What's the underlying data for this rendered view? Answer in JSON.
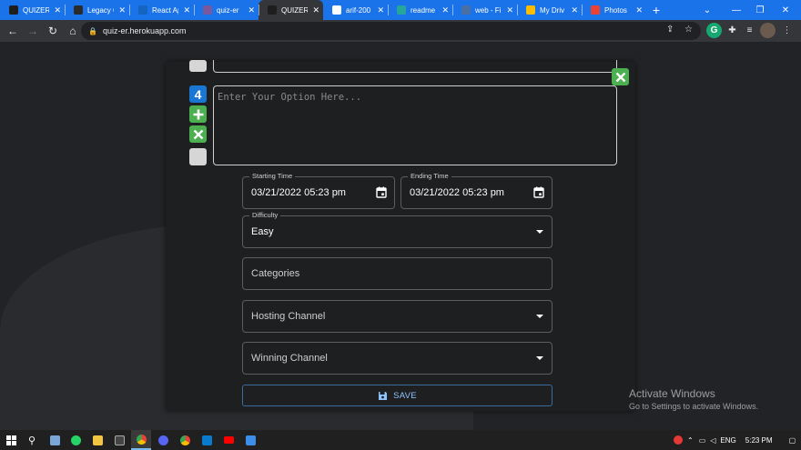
{
  "browser": {
    "tabs": [
      {
        "title": "QUIZER",
        "favicon": "quizer-icon",
        "color": "#1e1e1e",
        "active": false
      },
      {
        "title": "Legacy C",
        "favicon": "legacy-icon",
        "color": "#2b2b2b",
        "active": false
      },
      {
        "title": "React Ap",
        "favicon": "react-icon",
        "color": "#1565c0",
        "active": false
      },
      {
        "title": "quiz-er",
        "favicon": "heroku-icon",
        "color": "#79589f",
        "active": false
      },
      {
        "title": "QUIZER",
        "favicon": "quizer-icon",
        "color": "#1e1e1e",
        "active": true
      },
      {
        "title": "arif-200",
        "favicon": "github-icon",
        "color": "#ffffff",
        "active": false
      },
      {
        "title": "readme",
        "favicon": "readme-icon",
        "color": "#26a69a",
        "active": false
      },
      {
        "title": "web - Fi",
        "favicon": "web-icon",
        "color": "#4a6fa5",
        "active": false
      },
      {
        "title": "My Driv",
        "favicon": "drive-icon",
        "color": "#fbbc04",
        "active": false
      },
      {
        "title": "Photos",
        "favicon": "photos-icon",
        "color": "#ea4335",
        "active": false
      }
    ],
    "new_tab": "+",
    "url": "quiz-er.herokuapp.com",
    "window_controls": {
      "tab_search": "⌄",
      "minimize": "—",
      "restore": "❐",
      "close": "✕"
    }
  },
  "form": {
    "option_number": "4",
    "option_placeholder": "Enter Your Option Here...",
    "starting_time": {
      "label": "Starting Time",
      "value": "03/21/2022 05:23 pm"
    },
    "ending_time": {
      "label": "Ending Time",
      "value": "03/21/2022 05:23 pm"
    },
    "difficulty": {
      "label": "Difficulty",
      "value": "Easy"
    },
    "categories": {
      "placeholder": "Categories"
    },
    "hosting_channel": {
      "placeholder": "Hosting Channel"
    },
    "winning_channel": {
      "placeholder": "Winning Channel"
    },
    "save_label": "SAVE"
  },
  "watermark": {
    "line1": "Activate Windows",
    "line2": "Go to Settings to activate Windows."
  },
  "taskbar": {
    "apps": [
      "windows-start",
      "search",
      "notepad",
      "whatsapp",
      "file-explorer",
      "terminal",
      "chrome",
      "discord",
      "chrome-alt",
      "vscode",
      "youtube",
      "photos"
    ],
    "lang": "ENG",
    "time": "5:23 PM"
  },
  "colors": {
    "accent": "#1a73e8",
    "green": "#4caf50",
    "blue_badge": "#1976d2",
    "save_text": "#8ec3ff"
  }
}
